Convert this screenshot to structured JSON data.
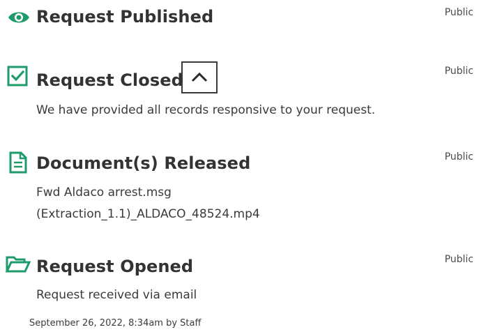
{
  "colors": {
    "accent": "#1f9a6a",
    "title": "#333333",
    "text": "#3a3a3a"
  },
  "timeline": [
    {
      "icon": "eye-icon",
      "title": "Request Published",
      "visibility": "Public"
    },
    {
      "icon": "checkbox-checked-icon",
      "title": "Request Closed",
      "visibility": "Public",
      "lines": [
        "We have provided all records responsive to your request."
      ],
      "collapse_icon": "chevron-up-icon"
    },
    {
      "icon": "document-icon",
      "title": "Document(s) Released",
      "visibility": "Public",
      "lines": [
        "Fwd Aldaco arrest.msg",
        "(Extraction_1.1)_ALDACO_48524.mp4"
      ]
    },
    {
      "icon": "folder-open-icon",
      "title": "Request Opened",
      "visibility": "Public",
      "lines": [
        "Request received via email"
      ],
      "meta": "September 26, 2022, 8:34am by Staff"
    }
  ]
}
